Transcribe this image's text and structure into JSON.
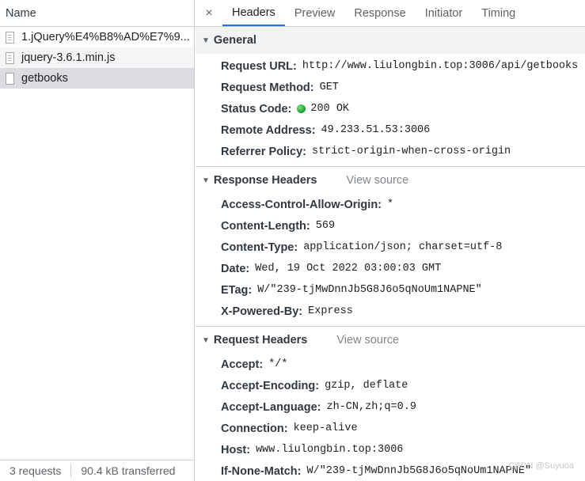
{
  "left": {
    "header": "Name",
    "requests": [
      {
        "name": "1.jQuery%E4%B8%AD%E7%9..."
      },
      {
        "name": "jquery-3.6.1.min.js"
      },
      {
        "name": "getbooks"
      }
    ],
    "footer": {
      "count": "3 requests",
      "transferred": "90.4 kB transferred"
    }
  },
  "tabs": [
    "Headers",
    "Preview",
    "Response",
    "Initiator",
    "Timing"
  ],
  "close_icon": "×",
  "general": {
    "title": "General",
    "rows": [
      {
        "k": "Request URL:",
        "v": "http://www.liulongbin.top:3006/api/getbooks"
      },
      {
        "k": "Request Method:",
        "v": "GET"
      },
      {
        "k": "Status Code:",
        "v": "200 OK"
      },
      {
        "k": "Remote Address:",
        "v": "49.233.51.53:3006"
      },
      {
        "k": "Referrer Policy:",
        "v": "strict-origin-when-cross-origin"
      }
    ]
  },
  "response_headers": {
    "title": "Response Headers",
    "view_source": "View source",
    "rows": [
      {
        "k": "Access-Control-Allow-Origin:",
        "v": "*"
      },
      {
        "k": "Content-Length:",
        "v": "569"
      },
      {
        "k": "Content-Type:",
        "v": "application/json; charset=utf-8"
      },
      {
        "k": "Date:",
        "v": "Wed, 19 Oct 2022 03:00:03 GMT"
      },
      {
        "k": "ETag:",
        "v": "W/\"239-tjMwDnnJb5G8J6o5qNoUm1NAPNE\""
      },
      {
        "k": "X-Powered-By:",
        "v": "Express"
      }
    ]
  },
  "request_headers": {
    "title": "Request Headers",
    "view_source": "View source",
    "rows": [
      {
        "k": "Accept:",
        "v": "*/*"
      },
      {
        "k": "Accept-Encoding:",
        "v": "gzip, deflate"
      },
      {
        "k": "Accept-Language:",
        "v": "zh-CN,zh;q=0.9"
      },
      {
        "k": "Connection:",
        "v": "keep-alive"
      },
      {
        "k": "Host:",
        "v": "www.liulongbin.top:3006"
      },
      {
        "k": "If-None-Match:",
        "v": "W/\"239-tjMwDnnJb5G8J6o5qNoUm1NAPNE\""
      }
    ]
  },
  "watermark": "CSDN @Suyuoa",
  "colors": {
    "accent": "#1a73e8",
    "status_ok": "#0f9d2a",
    "selected_row": "#dadce0"
  }
}
